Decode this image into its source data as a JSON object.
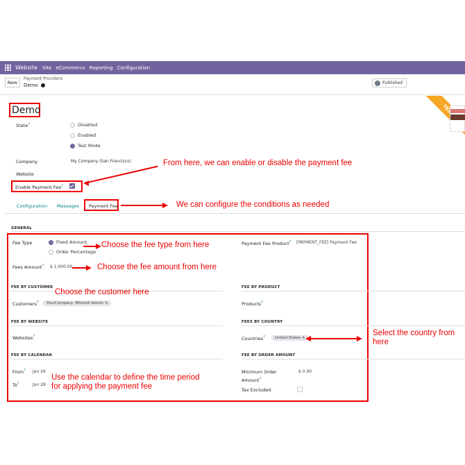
{
  "navbar": {
    "app": "Website",
    "items": [
      "Site",
      "eCommerce",
      "Reporting",
      "Configuration"
    ]
  },
  "control": {
    "new_label": "New",
    "breadcrumb_parent": "Payment Providers",
    "breadcrumb_current": "Demo",
    "published_label": "Published"
  },
  "form": {
    "title": "Demo",
    "ribbon": "TEST MODE",
    "state_label": "State",
    "state_options": [
      "Disabled",
      "Enabled",
      "Test Mode"
    ],
    "state_selected": "Test Mode",
    "company_label": "Company",
    "company_value": "My Company (San Francisco)",
    "website_label": "Website",
    "enable_fee_label": "Enable Payment Fee",
    "enable_fee_checked": true
  },
  "tabs": [
    "Configuration",
    "Messages",
    "Payment Fee"
  ],
  "active_tab": "Payment Fee",
  "fee": {
    "general_header": "GENERAL",
    "fee_type_label": "Fee Type",
    "fee_type_options": [
      "Fixed Amount",
      "Order Percentage"
    ],
    "fee_type_selected": "Fixed Amount",
    "product_label": "Payment Fee Product",
    "product_value": "[PAYMENT_FEE] Payment Fee",
    "amount_label": "Fees Amount",
    "amount_value": "$ 1,000.00",
    "by_customer_header": "FEE BY CUSTOMER",
    "customers_label": "Customers",
    "customers_tag": "YourCompany, Mitchell Admin",
    "by_product_header": "FEE BY PRODUCT",
    "products_label": "Products",
    "by_website_header": "FEE BY WEBSITE",
    "websites_label": "Websites",
    "by_country_header": "FEES BY COUNTRY",
    "countries_label": "Countries",
    "countries_tag": "United States",
    "by_calendar_header": "FEE BY CALENDAR",
    "from_label": "From",
    "from_value": "Jan 26",
    "to_label": "To",
    "to_value": "Jan 28",
    "by_order_amount_header": "FEE BY ORDER AMOUNT",
    "min_order_label_1": "Minimum Order",
    "min_order_label_2": "Amount",
    "min_order_value": "$ 0.00",
    "tax_excluded_label": "Tax Excluded"
  },
  "annotations": {
    "enable_fee": "From here, we can enable or disable the payment fee",
    "configure": "We can configure the conditions as needed",
    "fee_type": "Choose the fee type from here",
    "fee_amount": "Choose the fee amount from here",
    "customer": "Choose the customer here",
    "country_1": "Select the country from",
    "country_2": "here",
    "calendar_1": "Use the calendar to define the time period",
    "calendar_2": "for applying the payment fee"
  },
  "colors": {
    "navbar": "#71639e",
    "annotation_red": "#e00000",
    "ribbon": "#f5a623",
    "link": "#017e84"
  }
}
